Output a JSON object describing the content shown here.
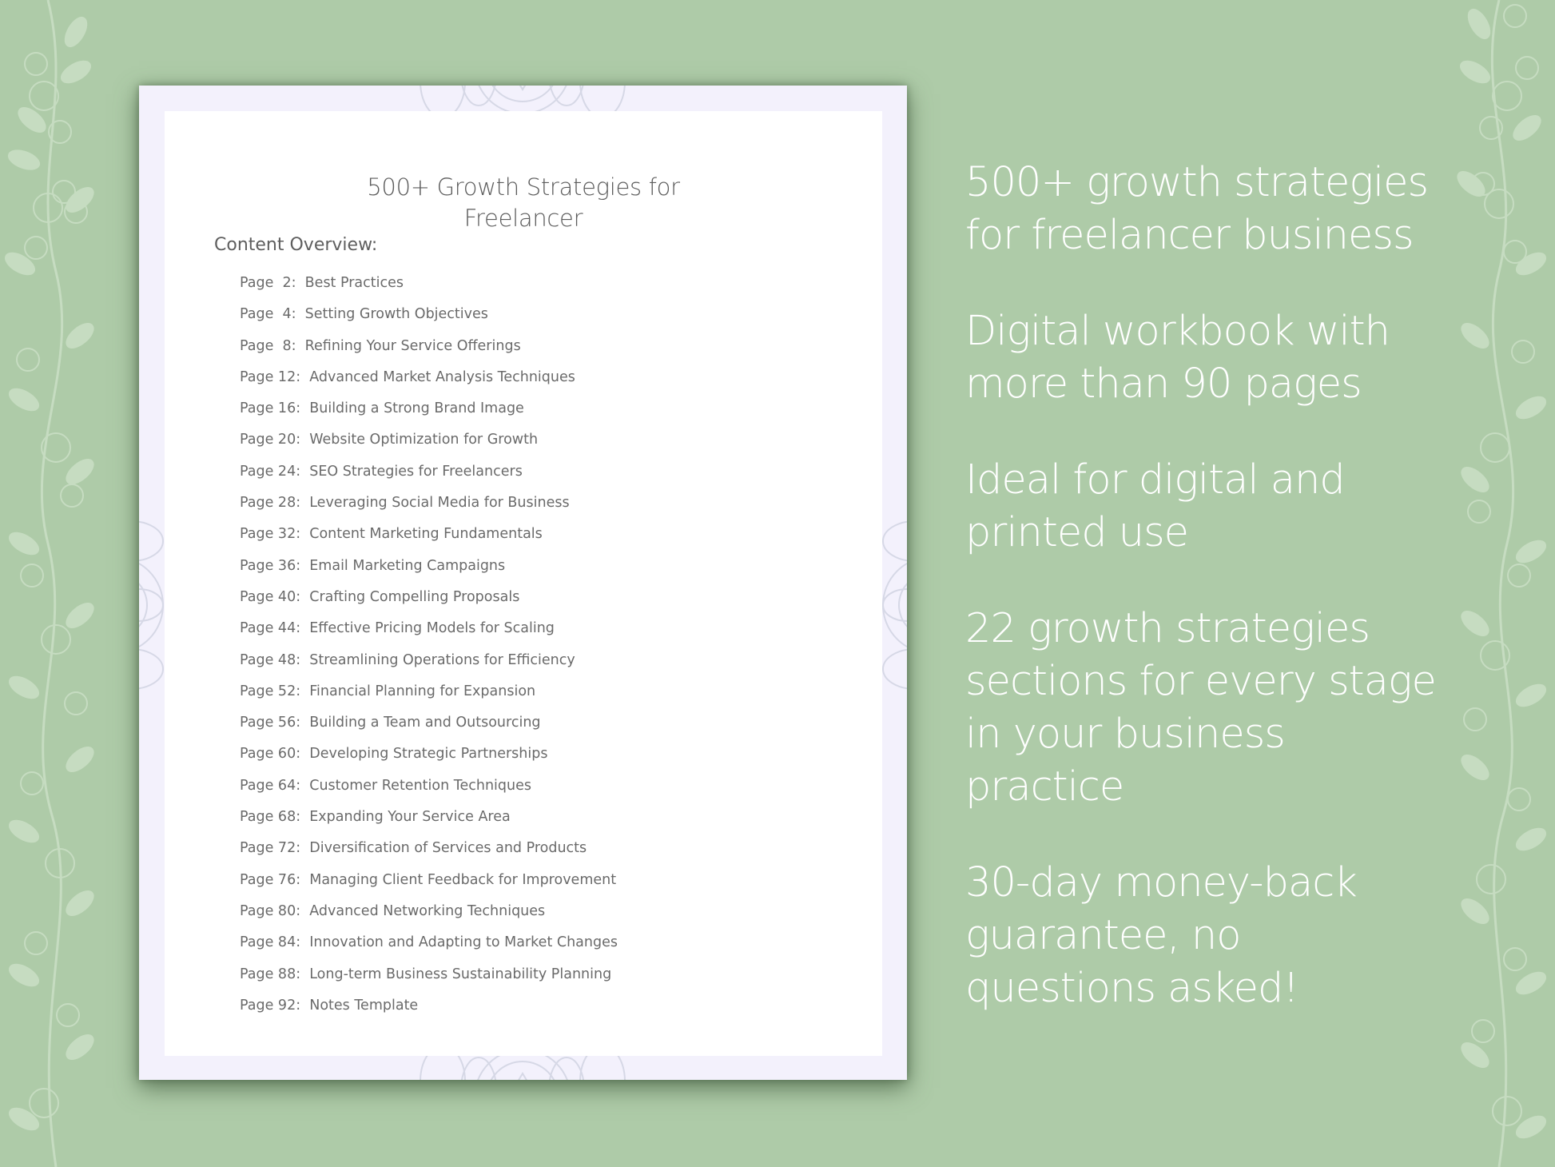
{
  "document": {
    "title_lines": [
      "500+ Growth Strategies for",
      "Freelancer"
    ],
    "overview_label": "Content Overview:",
    "toc": [
      {
        "page": "Page  2:",
        "topic": "Best Practices"
      },
      {
        "page": "Page  4:",
        "topic": "Setting Growth Objectives"
      },
      {
        "page": "Page  8:",
        "topic": "Refining Your Service Offerings"
      },
      {
        "page": "Page 12:",
        "topic": "Advanced Market Analysis Techniques"
      },
      {
        "page": "Page 16:",
        "topic": "Building a Strong Brand Image"
      },
      {
        "page": "Page 20:",
        "topic": "Website Optimization for Growth"
      },
      {
        "page": "Page 24:",
        "topic": "SEO Strategies for Freelancers"
      },
      {
        "page": "Page 28:",
        "topic": "Leveraging Social Media for Business"
      },
      {
        "page": "Page 32:",
        "topic": "Content Marketing Fundamentals"
      },
      {
        "page": "Page 36:",
        "topic": "Email Marketing Campaigns"
      },
      {
        "page": "Page 40:",
        "topic": "Crafting Compelling Proposals"
      },
      {
        "page": "Page 44:",
        "topic": "Effective Pricing Models for Scaling"
      },
      {
        "page": "Page 48:",
        "topic": "Streamlining Operations for Efficiency"
      },
      {
        "page": "Page 52:",
        "topic": "Financial Planning for Expansion"
      },
      {
        "page": "Page 56:",
        "topic": "Building a Team and Outsourcing"
      },
      {
        "page": "Page 60:",
        "topic": "Developing Strategic Partnerships"
      },
      {
        "page": "Page 64:",
        "topic": "Customer Retention Techniques"
      },
      {
        "page": "Page 68:",
        "topic": "Expanding Your Service Area"
      },
      {
        "page": "Page 72:",
        "topic": "Diversification of Services and Products"
      },
      {
        "page": "Page 76:",
        "topic": "Managing Client Feedback for Improvement"
      },
      {
        "page": "Page 80:",
        "topic": "Advanced Networking Techniques"
      },
      {
        "page": "Page 84:",
        "topic": "Innovation and Adapting to Market Changes"
      },
      {
        "page": "Page 88:",
        "topic": "Long-term Business Sustainability Planning"
      },
      {
        "page": "Page 92:",
        "topic": "Notes Template"
      }
    ]
  },
  "features": [
    {
      "lines": [
        "500+ growth strategies",
        "for freelancer business"
      ]
    },
    {
      "lines": [
        "Digital workbook with",
        "more than 90 pages"
      ]
    },
    {
      "lines": [
        "Ideal for digital and",
        "printed use"
      ]
    },
    {
      "lines": [
        "22 growth strategies",
        "sections for every stage",
        "in your business",
        "practice"
      ]
    },
    {
      "lines": [
        "30-day money-back",
        "guarantee, no",
        "questions asked!"
      ]
    }
  ],
  "colors": {
    "background": "#aecba8",
    "page_border": "#f3f1fc",
    "feature_text": "#ffffff",
    "doc_text": "#5b5b5b"
  }
}
